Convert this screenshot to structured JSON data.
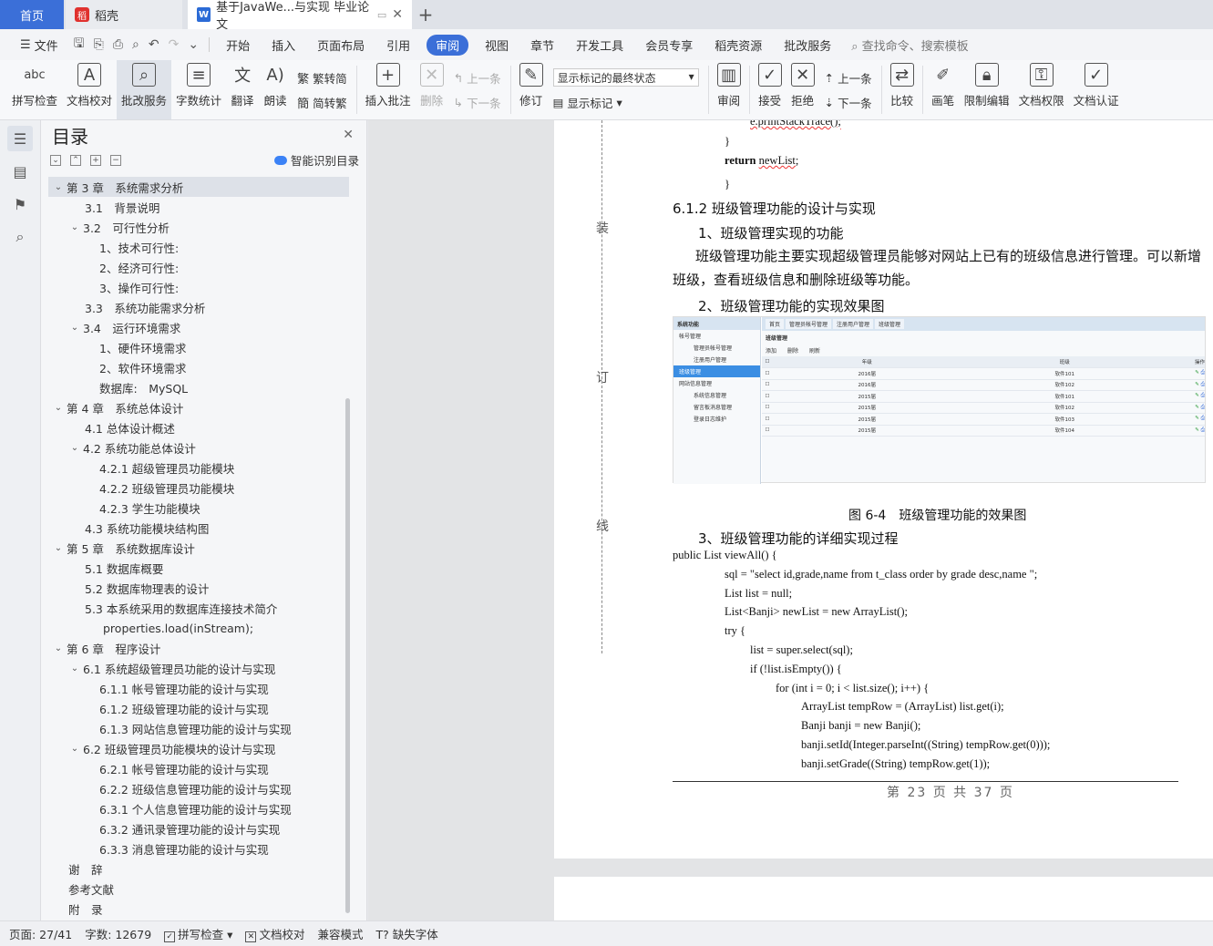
{
  "tabs": {
    "home": "首页",
    "daoke": "稻壳",
    "doc": "基于JavaWe...与实现 毕业论文"
  },
  "menu": {
    "file": "文件",
    "items": [
      "开始",
      "插入",
      "页面布局",
      "引用",
      "审阅",
      "视图",
      "章节",
      "开发工具",
      "会员专享",
      "稻壳资源",
      "批改服务"
    ],
    "active_index": 4,
    "search": "查找命令、搜索模板"
  },
  "ribbon": {
    "spell": "拼写检查",
    "doc_check": "文档校对",
    "review_service": "批改服务",
    "word_count": "字数统计",
    "translate": "翻译",
    "read_aloud": "朗读",
    "to_traditional": "繁转简",
    "to_simplified": "简转繁",
    "insert_comment": "插入批注",
    "delete": "删除",
    "prev": "上一条",
    "next": "下一条",
    "revise": "修订",
    "markup_state": "显示标记的最终状态",
    "show_markup": "显示标记",
    "review": "审阅",
    "accept": "接受",
    "reject": "拒绝",
    "prev2": "上一条",
    "next2": "下一条",
    "compare": "比较",
    "pen": "画笔",
    "restrict_edit": "限制编辑",
    "doc_permission": "文档权限",
    "doc_cert": "文档认证"
  },
  "toc": {
    "title": "目录",
    "smart": "智能识别目录",
    "items": [
      {
        "label": "第 3 章　系统需求分析",
        "level": 0,
        "arrow": "v",
        "sel": true
      },
      {
        "label": "3.1　背景说明",
        "level": 1,
        "arrow": ""
      },
      {
        "label": "3.2　可行性分析",
        "level": 1,
        "arrow": "v"
      },
      {
        "label": "1、技术可行性:",
        "level": 2,
        "arrow": ""
      },
      {
        "label": "2、经济可行性:",
        "level": 2,
        "arrow": ""
      },
      {
        "label": "3、操作可行性:",
        "level": 2,
        "arrow": ""
      },
      {
        "label": "3.3　系统功能需求分析",
        "level": 1,
        "arrow": ""
      },
      {
        "label": "3.4　运行环境需求",
        "level": 1,
        "arrow": "v"
      },
      {
        "label": "1、硬件环境需求",
        "level": 2,
        "arrow": ""
      },
      {
        "label": "2、软件环境需求",
        "level": 2,
        "arrow": ""
      },
      {
        "label": "数据库:　MySQL",
        "level": 2,
        "arrow": ""
      },
      {
        "label": "第 4 章　系统总体设计",
        "level": 0,
        "arrow": "v"
      },
      {
        "label": "4.1 总体设计概述",
        "level": 1,
        "arrow": ""
      },
      {
        "label": "4.2 系统功能总体设计",
        "level": 1,
        "arrow": "v"
      },
      {
        "label": "4.2.1 超级管理员功能模块",
        "level": 2,
        "arrow": ""
      },
      {
        "label": "4.2.2 班级管理员功能模块",
        "level": 2,
        "arrow": ""
      },
      {
        "label": "4.2.3 学生功能模块",
        "level": 2,
        "arrow": ""
      },
      {
        "label": "4.3 系统功能模块结构图",
        "level": 1,
        "arrow": ""
      },
      {
        "label": "第 5 章　系统数据库设计",
        "level": 0,
        "arrow": "v"
      },
      {
        "label": "5.1 数据库概要",
        "level": 1,
        "arrow": ""
      },
      {
        "label": "5.2  数据库物理表的设计",
        "level": 1,
        "arrow": ""
      },
      {
        "label": "5.3  本系统采用的数据库连接技术简介",
        "level": 1,
        "arrow": ""
      },
      {
        "label": "properties.load(inStream);",
        "level": 1,
        "arrow": "",
        "indent": 28
      },
      {
        "label": "第 6 章　程序设计",
        "level": 0,
        "arrow": "v"
      },
      {
        "label": "6.1 系统超级管理员功能的设计与实现",
        "level": 1,
        "arrow": "v"
      },
      {
        "label": "6.1.1  帐号管理功能的设计与实现",
        "level": 2,
        "arrow": ""
      },
      {
        "label": "6.1.2 班级管理功能的设计与实现",
        "level": 2,
        "arrow": ""
      },
      {
        "label": "6.1.3 网站信息管理功能的设计与实现",
        "level": 2,
        "arrow": ""
      },
      {
        "label": "6.2 班级管理员功能模块的设计与实现",
        "level": 1,
        "arrow": "v"
      },
      {
        "label": "6.2.1 帐号管理功能的设计与实现",
        "level": 2,
        "arrow": ""
      },
      {
        "label": "6.2.2 班级信息管理功能的设计与实现",
        "level": 2,
        "arrow": ""
      },
      {
        "label": "6.3.1 个人信息管理功能的设计与实现",
        "level": 2,
        "arrow": ""
      },
      {
        "label": "6.3.2 通讯录管理功能的设计与实现",
        "level": 2,
        "arrow": ""
      },
      {
        "label": "6.3.3 消息管理功能的设计与实现",
        "level": 2,
        "arrow": ""
      },
      {
        "label": "谢　辞",
        "level": 0,
        "arrow": ""
      },
      {
        "label": "参考文献",
        "level": 0,
        "arrow": ""
      },
      {
        "label": "附　录",
        "level": 0,
        "arrow": ""
      }
    ]
  },
  "doc": {
    "binding": [
      "装",
      "订",
      "线"
    ],
    "code_top": [
      "e.printStackTrace();",
      "}",
      "return newList;",
      "}"
    ],
    "h_612": "6.1.2 班级管理功能的设计与实现",
    "h_1": "1、班级管理实现的功能",
    "para": "班级管理功能主要实现超级管理员能够对网站上已有的班级信息进行管理。可以新增班级，查看班级信息和删除班级等功能。",
    "h_2": "2、班级管理功能的实现效果图",
    "caption": "图 6-4　班级管理功能的效果图",
    "h_3": "3、班级管理功能的详细实现过程",
    "code": [
      "public List viewAll() {",
      "sql = \"select id,grade,name from t_class order by grade desc,name \";",
      "List list = null;",
      "List<Banji> newList = new ArrayList();",
      "try {",
      "list = super.select(sql);",
      "if (!list.isEmpty()) {",
      "for (int i = 0; i < list.size(); i++) {",
      "ArrayList tempRow = (ArrayList) list.get(i);",
      "Banji banji = new  Banji();",
      "banji.setId(Integer.parseInt((String) tempRow.get(0)));",
      "banji.setGrade((String) tempRow.get(1));"
    ],
    "footer": "第 23 页 共 37 页"
  },
  "shot": {
    "side_title": "系统功能",
    "side_items": [
      "帐号管理",
      "管理员帐号管理",
      "注册用户管理",
      "班级管理",
      "网站信息管理",
      "系统信息管理",
      "留言板消息管理",
      "登录日志维护"
    ],
    "tabs": [
      "首页",
      "管理员帐号管理",
      "注册用户管理",
      "班级管理"
    ],
    "page_title": "班级管理",
    "buttons": [
      "添加",
      "删除",
      "刷新"
    ],
    "columns": [
      "年级",
      "班级",
      "操作"
    ],
    "rows": [
      [
        "2016届",
        "软件101"
      ],
      [
        "2016届",
        "软件102"
      ],
      [
        "2015届",
        "软件101"
      ],
      [
        "2015届",
        "软件102"
      ],
      [
        "2015届",
        "软件103"
      ],
      [
        "2015届",
        "软件104"
      ]
    ]
  },
  "status": {
    "page": "页面: 27/41",
    "words": "字数: 12679",
    "spell": "拼写检查",
    "doc_check": "文档校对",
    "compat": "兼容模式",
    "missing_font": "缺失字体"
  }
}
